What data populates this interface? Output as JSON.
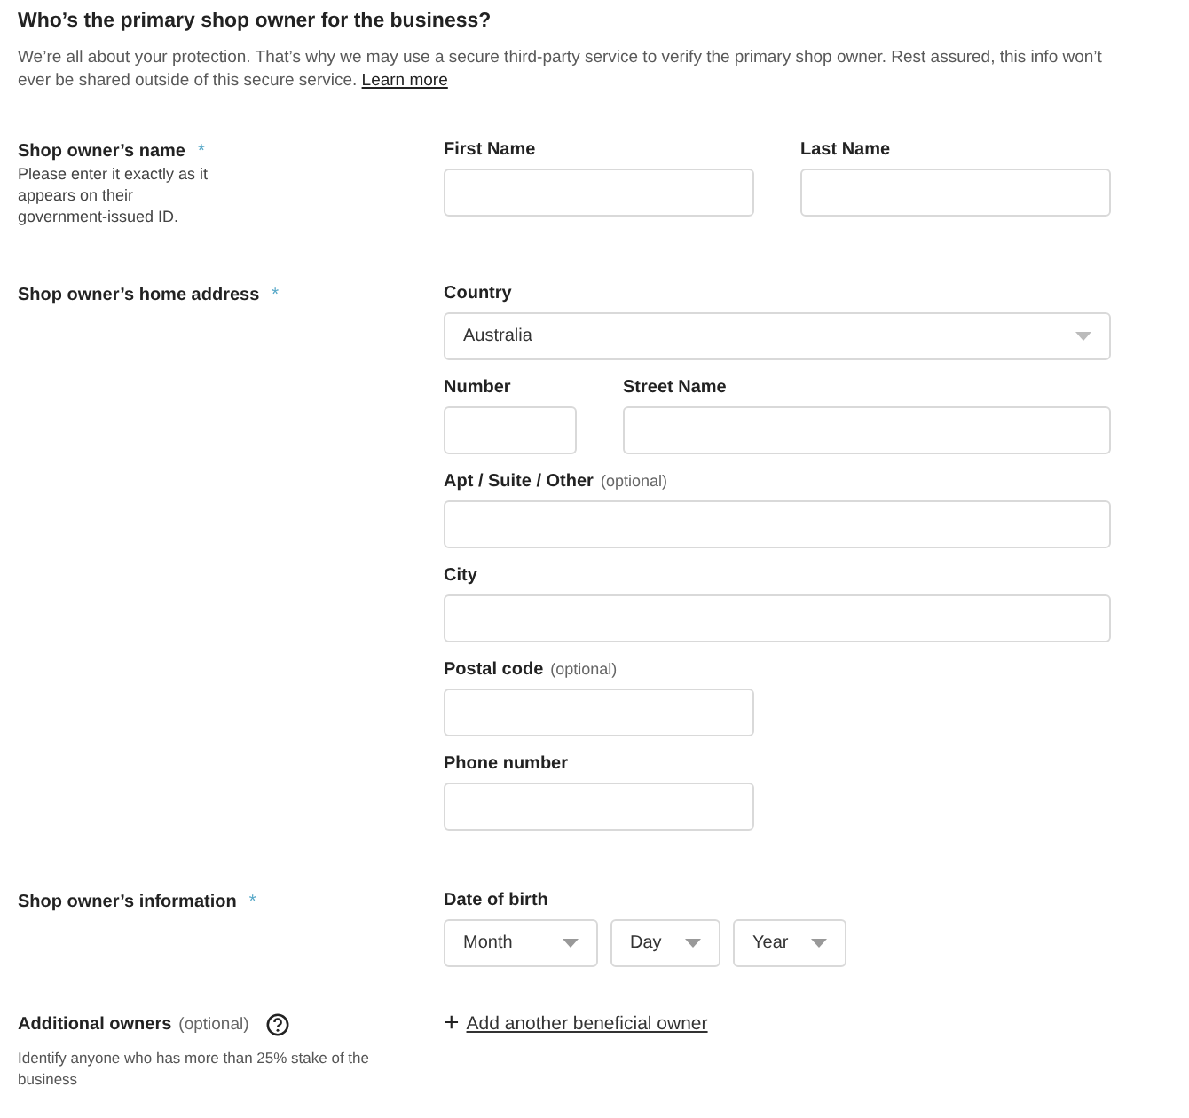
{
  "heading": "Who’s the primary shop owner for the business?",
  "intro": {
    "text": "We’re all about your protection. That’s why we may use a secure third-party service to verify the primary shop owner. Rest assured, this info won’t ever be shared outside of this secure service.",
    "link": "Learn more"
  },
  "sections": [
    {
      "label": "Shop owner’s name",
      "required_mark": "*",
      "hint": "Please enter it exactly as it appears on their government-issued ID.",
      "rows": [
        [
          {
            "kind": "input",
            "label": "First Name"
          },
          {
            "kind": "input",
            "label": "Last Name"
          }
        ]
      ]
    },
    {
      "label": "Shop owner’s home address",
      "required_mark": "*",
      "rows": [
        [
          {
            "kind": "select",
            "label": "Country",
            "value": "Australia"
          }
        ],
        [
          {
            "kind": "input",
            "label": "Number"
          },
          {
            "kind": "input",
            "label": "Street Name"
          }
        ],
        [
          {
            "kind": "input",
            "label": "Apt / Suite / Other",
            "optional": "(optional)"
          }
        ],
        [
          {
            "kind": "input",
            "label": "City"
          }
        ],
        [
          {
            "kind": "input",
            "label": "Postal code",
            "optional": "(optional)"
          }
        ],
        [
          {
            "kind": "input",
            "label": "Phone number"
          }
        ]
      ]
    },
    {
      "label": "Shop owner’s information",
      "required_mark": "*",
      "date": {
        "label": "Date of birth",
        "selects": [
          "Month",
          "Day",
          "Year"
        ]
      }
    },
    {
      "label": "Additional owners",
      "optional": "(optional)",
      "help": true,
      "hint": "Identify anyone who has more than 25% stake of the business",
      "action": {
        "icon": "+",
        "label": "Add another beneficial owner"
      }
    }
  ]
}
